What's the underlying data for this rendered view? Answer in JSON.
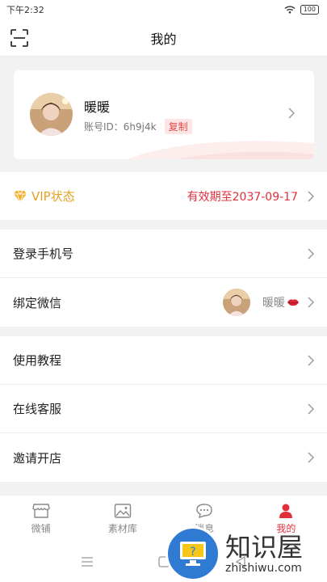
{
  "status_bar": {
    "time": "下午2:32",
    "battery": "100"
  },
  "header": {
    "title": "我的"
  },
  "profile": {
    "nickname": "暖暖",
    "account_id": "账号ID：6h9j4k",
    "copy_label": "复制"
  },
  "vip": {
    "label": "VIP状态",
    "expiry": "有效期至2037-09-17"
  },
  "account_settings": {
    "phone_label": "登录手机号",
    "wechat_label": "绑定微信",
    "wechat_name": "暖暖"
  },
  "help": {
    "tutorial_label": "使用教程",
    "service_label": "在线客服",
    "invite_label": "邀请开店"
  },
  "tab_bar": {
    "tabs": [
      {
        "label": "微铺",
        "icon": "shop-icon"
      },
      {
        "label": "素材库",
        "icon": "image-icon"
      },
      {
        "label": "消息",
        "icon": "chat-icon"
      },
      {
        "label": "我的",
        "icon": "person-icon"
      }
    ]
  },
  "watermark": {
    "cn": "知识屋",
    "en": "zhishiwu.com"
  },
  "colors": {
    "accent": "#e0303a",
    "vip": "#e5a021",
    "copy_bg": "#fde5e5"
  }
}
